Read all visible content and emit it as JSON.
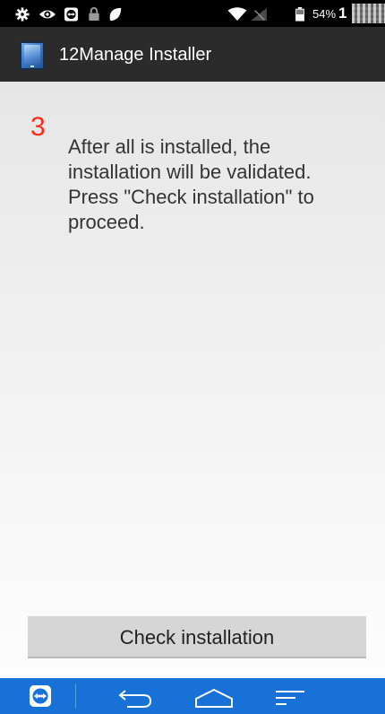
{
  "status_bar": {
    "icons": [
      "gear-icon",
      "eye-icon",
      "teamviewer-icon",
      "lock-icon",
      "leaf-icon",
      "wifi-icon",
      "no-signal-icon",
      "battery-icon"
    ],
    "battery_text": "54%",
    "clock_text": "1"
  },
  "action_bar": {
    "app_icon": "tablet-app-icon",
    "title": "12Manage Installer"
  },
  "content": {
    "step_number": "3",
    "step_text": "After all is installed, the installation will be validated. Press \"Check installation\" to proceed.",
    "button_label": "Check installation"
  },
  "nav_bar": {
    "icons": [
      "teamviewer-nav-icon",
      "back-icon",
      "home-icon",
      "recents-icon"
    ]
  },
  "colors": {
    "status_bar_bg": "#000000",
    "action_bar_bg": "#2b2b2b",
    "step_number_color": "#ff2a1a",
    "nav_bar_bg": "#1771d6",
    "button_bg": "#d6d6d6"
  }
}
